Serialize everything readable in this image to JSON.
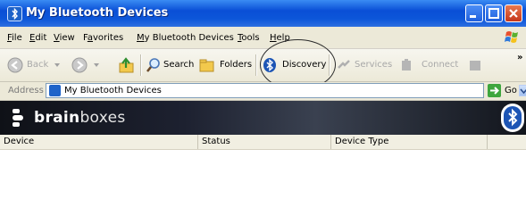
{
  "window": {
    "title": "My Bluetooth Devices"
  },
  "menu": [
    {
      "label": "File",
      "key": "F",
      "rest": "ile"
    },
    {
      "label": "Edit",
      "key": "E",
      "rest": "dit"
    },
    {
      "label": "View",
      "key": "V",
      "rest": "iew"
    },
    {
      "label": "Favorites",
      "key": "a",
      "pre": "F",
      "rest": "vorites"
    },
    {
      "label": "My Bluetooth Devices",
      "key": "M",
      "rest": "y Bluetooth Devices"
    },
    {
      "label": "Tools",
      "key": "T",
      "rest": "ools"
    },
    {
      "label": "Help",
      "key": "H",
      "rest": "elp"
    }
  ],
  "toolbar": {
    "back": "Back",
    "search": "Search",
    "folders": "Folders",
    "discovery": "Discovery",
    "services": "Services",
    "connect": "Connect",
    "more": "»"
  },
  "address": {
    "label": "Address",
    "value": "My Bluetooth Devices",
    "go": "Go"
  },
  "banner": {
    "brand_bold": "brain",
    "brand_light": "boxes"
  },
  "columns": [
    "Device",
    "Status",
    "Device Type"
  ],
  "colors": {
    "titlebar": "#0a4fd6",
    "chrome": "#ece9d8",
    "bluetooth": "#1d55b5"
  }
}
